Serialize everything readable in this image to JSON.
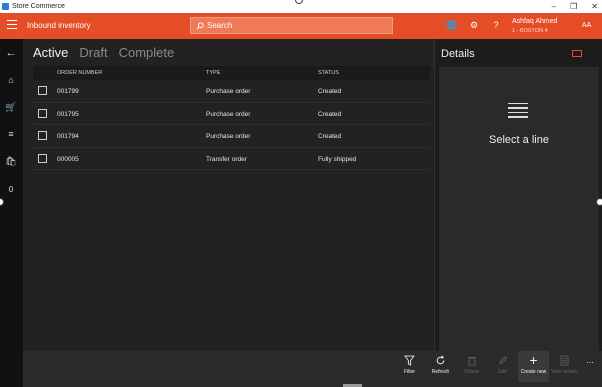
{
  "window": {
    "title": "Store Commerce"
  },
  "header": {
    "menu_icon": "hamburger-icon",
    "page_title": "Inbound inventory",
    "search_placeholder": "Search",
    "user_name": "Ashfaq Ahmed",
    "user_store": "1 - BOSTON 4",
    "user_initials": "AA",
    "accent": "#e44d26"
  },
  "rail": {
    "items": [
      "back-arrow-icon",
      "home-icon",
      "cart-icon",
      "menu-lines-icon",
      "bag-icon"
    ],
    "count": "0"
  },
  "tabs": [
    {
      "label": "Active"
    },
    {
      "label": "Draft"
    },
    {
      "label": "Complete"
    }
  ],
  "table": {
    "columns": [
      "ORDER NUMBER",
      "TYPE",
      "STATUS"
    ],
    "rows": [
      {
        "order": "001799",
        "type": "Purchase order",
        "status": "Created"
      },
      {
        "order": "001795",
        "type": "Purchase order",
        "status": "Created"
      },
      {
        "order": "001794",
        "type": "Purchase order",
        "status": "Created"
      },
      {
        "order": "000005",
        "type": "Transfer order",
        "status": "Fully shipped"
      }
    ]
  },
  "details": {
    "title": "Details",
    "empty_message": "Select a line"
  },
  "actions": [
    {
      "label": "Filter"
    },
    {
      "label": "Refresh"
    },
    {
      "label": "Delete"
    },
    {
      "label": "Edit"
    },
    {
      "label": "Create new"
    },
    {
      "label": "View details"
    },
    {
      "label": "..."
    }
  ]
}
